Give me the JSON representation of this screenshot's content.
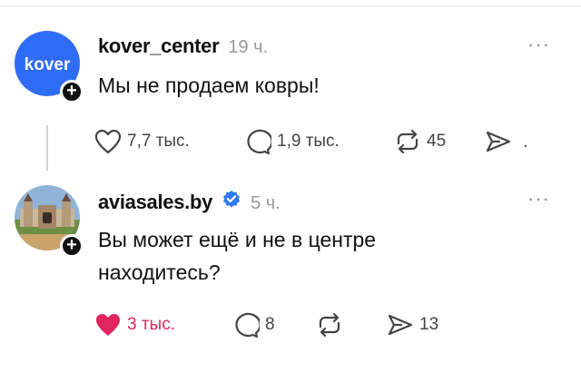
{
  "posts": [
    {
      "avatar_text": "kover",
      "username": "kover_center",
      "time": "19 ч.",
      "more": "···",
      "text": "Мы не продаем ковры!",
      "likes": "7,7 тыс.",
      "comments": "1,9 тыс.",
      "reposts": "45",
      "shares": "",
      "like_state": "not-liked"
    },
    {
      "username": "aviasales.by",
      "time": "5 ч.",
      "more": "···",
      "text": "Вы может ещё и не в центре находитесь?",
      "likes": "3 тыс.",
      "comments": "8",
      "reposts": "",
      "shares": "13",
      "like_state": "liked",
      "verified": true
    }
  ],
  "colors": {
    "avatar_blue": "#2f6cf6",
    "liked_red": "#e0245e",
    "verified_blue": "#2d7cf6"
  }
}
